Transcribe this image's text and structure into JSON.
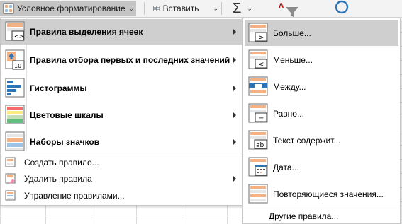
{
  "ribbon": {
    "conditional_formatting": "Условное форматирование",
    "insert": "Вставить",
    "autosum_symbol": "Σ",
    "sort_icon": "sort-filter-icon",
    "find_icon": "find-select-icon"
  },
  "menu": {
    "items": [
      {
        "label": "Правила выделения ячеек",
        "icon": "highlight-cells-rules-icon",
        "submenu": true,
        "active": true
      },
      {
        "label": "Правила отбора первых и последних значений",
        "icon": "top-bottom-rules-icon",
        "icon_text": "10",
        "submenu": true
      },
      {
        "label": "Гистограммы",
        "icon": "data-bars-icon",
        "submenu": true
      },
      {
        "label": "Цветовые шкалы",
        "icon": "color-scales-icon",
        "submenu": true
      },
      {
        "label": "Наборы значков",
        "icon": "icon-sets-icon",
        "submenu": true
      }
    ],
    "actions": [
      {
        "label": "Создать правило...",
        "icon": "new-rule-icon"
      },
      {
        "label": "Удалить правила",
        "icon": "clear-rules-icon",
        "submenu": true
      },
      {
        "label": "Управление правилами...",
        "icon": "manage-rules-icon"
      }
    ]
  },
  "submenu": {
    "items": [
      {
        "label": "Больше...",
        "icon": "greater-than-icon",
        "symbol": ">"
      },
      {
        "label": "Меньше...",
        "icon": "less-than-icon",
        "symbol": "<"
      },
      {
        "label": "Между...",
        "icon": "between-icon"
      },
      {
        "label": "Равно...",
        "icon": "equal-to-icon",
        "symbol": "="
      },
      {
        "label": "Текст содержит...",
        "icon": "text-contains-icon",
        "symbol": "ab"
      },
      {
        "label": "Дата...",
        "icon": "date-occurring-icon"
      },
      {
        "label": "Повторяющиеся значения...",
        "icon": "duplicate-values-icon"
      }
    ],
    "more_rules": "Другие правила..."
  },
  "colors": {
    "highlight": "#cfcfcf",
    "accent_orange": "#f4b183",
    "accent_blue": "#2e75b6",
    "menu_border": "#c6c6c6"
  }
}
